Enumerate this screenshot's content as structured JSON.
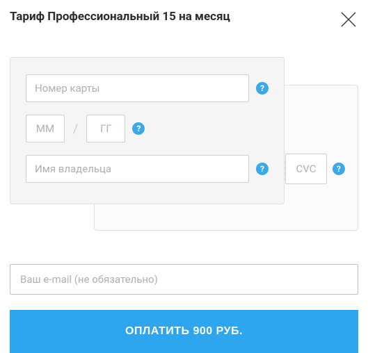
{
  "title": "Тариф Профессиональный 15 на месяц",
  "card": {
    "number_placeholder": "Номер карты",
    "month_placeholder": "ММ",
    "year_placeholder": "ГГ",
    "holder_placeholder": "Имя владельца",
    "cvc_placeholder": "CVC",
    "slash": "/",
    "help": "?"
  },
  "email_placeholder": "Ваш e-mail (не обязательно)",
  "pay_button": "ОПЛАТИТЬ 900 РУБ.",
  "colors": {
    "accent": "#2ea5ef",
    "help": "#3da8e8"
  }
}
